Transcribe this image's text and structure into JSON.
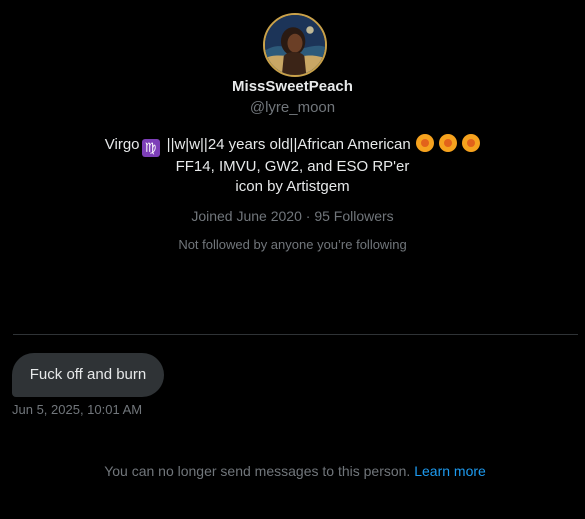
{
  "profile": {
    "display_name": "MissSweetPeach",
    "handle": "@lyre_moon",
    "bio": {
      "line1_prefix": "Virgo",
      "zodiac_symbol": "♍",
      "line1_text": " ||w|w||24 years old||African American ",
      "line2": "FF14, IMVU, GW2, and ESO RP'er",
      "line3": "icon by Artistgem"
    },
    "joined": "Joined June 2020",
    "separator": " · ",
    "followers": "95 Followers",
    "not_followed": "Not followed by anyone you’re following",
    "avatar_icon": "profile-avatar",
    "emoji_icon": "blossom-emoji",
    "zodiac_icon": "virgo-emoji"
  },
  "conversation": {
    "messages": [
      {
        "text": "Fuck off and burn",
        "timestamp": "Jun 5, 2025, 10:01 AM"
      }
    ]
  },
  "footer": {
    "notice": "You can no longer send messages to this person.",
    "learn_more": "Learn more"
  },
  "colors": {
    "background": "#000000",
    "primary_text": "#e7e9ea",
    "secondary_text": "#71767b",
    "bubble": "#2f3336",
    "link": "#1d9bf0",
    "divider": "#2f3336"
  }
}
